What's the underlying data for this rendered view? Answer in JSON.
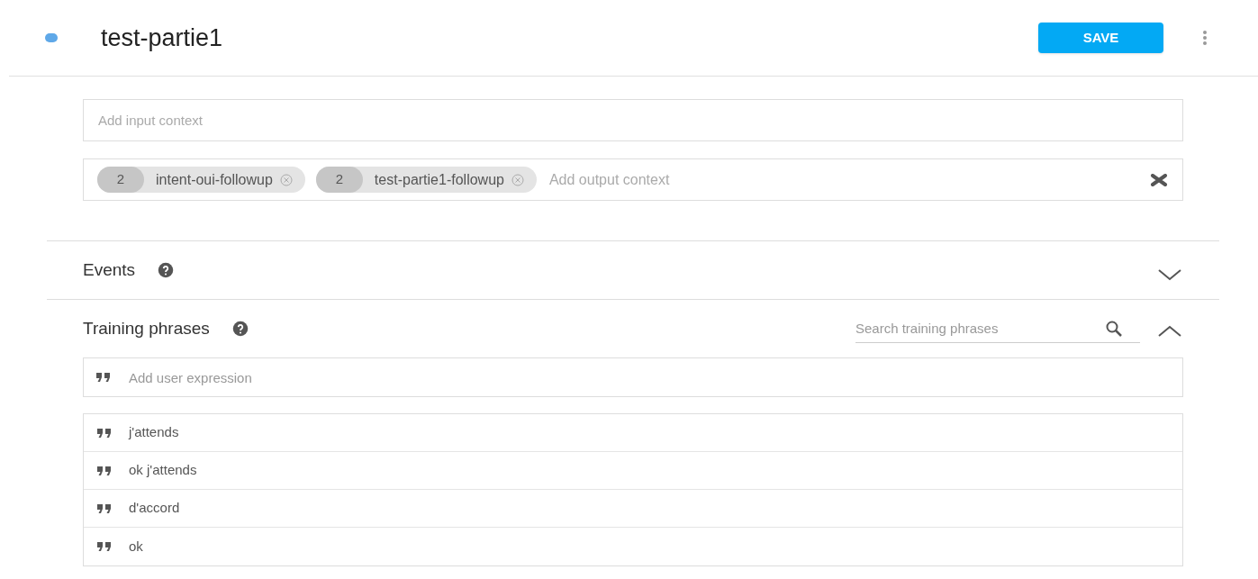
{
  "header": {
    "title": "test-partie1",
    "save_button": "SAVE"
  },
  "contexts": {
    "input": {
      "placeholder": "Add input context"
    },
    "output": {
      "placeholder": "Add output context",
      "chips": [
        {
          "count": "2",
          "label": "intent-oui-followup"
        },
        {
          "count": "2",
          "label": "test-partie1-followup"
        }
      ]
    }
  },
  "sections": [
    {
      "title": "Events",
      "expanded": false
    },
    {
      "title": "Training phrases",
      "expanded": true,
      "search": {
        "placeholder": "Search training phrases"
      },
      "add": {
        "placeholder": "Add user expression"
      },
      "phrases": [
        "j'attends",
        "ok j'attends",
        "d'accord",
        "ok"
      ]
    }
  ]
}
